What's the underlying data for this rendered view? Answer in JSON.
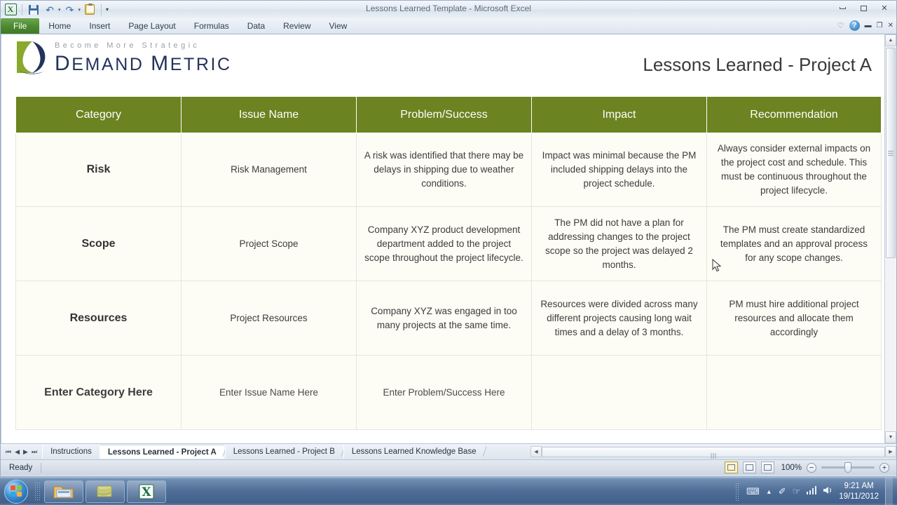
{
  "window": {
    "title": "Lessons Learned Template  -  Microsoft Excel",
    "minimize_label": "Minimize",
    "restore_label": "Restore Down",
    "close_label": "Close"
  },
  "quick_access": {
    "excel_logo": "X",
    "save_label": "Save",
    "undo_label": "Undo",
    "redo_label": "Redo",
    "print_preview_label": "Print Preview and Print",
    "customize_label": "Customize Quick Access Toolbar",
    "undo_glyph": "↶",
    "redo_glyph": "↷",
    "caret_glyph": "▾"
  },
  "ribbon": {
    "tabs": [
      {
        "label": "File",
        "active": true
      },
      {
        "label": "Home",
        "active": false
      },
      {
        "label": "Insert",
        "active": false
      },
      {
        "label": "Page Layout",
        "active": false
      },
      {
        "label": "Formulas",
        "active": false
      },
      {
        "label": "Data",
        "active": false
      },
      {
        "label": "Review",
        "active": false
      },
      {
        "label": "View",
        "active": false
      }
    ],
    "help_glyph": "?",
    "heart_glyph": "♡",
    "minimize_ribbon_glyph": "▬",
    "restore_ribbon_glyph": "❐",
    "close_ribbon_glyph": "✕"
  },
  "document": {
    "brand_tagline": "Become More Strategic",
    "brand_name_1": "D",
    "brand_name_2": "EMAND ",
    "brand_name_3": "M",
    "brand_name_4": "ETRIC",
    "brand_name_full": "DEMAND METRIC",
    "title": "Lessons Learned - Project A",
    "colors": {
      "header_green": "#6b8320",
      "logo_green": "#8aa82e",
      "logo_navy": "#22335c",
      "cell_bg": "#fdfdf5",
      "cell_border": "#e6e6de"
    }
  },
  "table": {
    "columns": [
      "Category",
      "Issue Name",
      "Problem/Success",
      "Impact",
      "Recommendation"
    ],
    "rows": [
      {
        "category": "Risk",
        "issue_name": "Risk Management",
        "problem_success": "A risk was identified that there may be delays in shipping due to weather conditions.",
        "impact": "Impact was minimal because the PM included shipping delays into the project schedule.",
        "recommendation": "Always consider external impacts on the project cost and schedule. This must be continuous throughout the project lifecycle."
      },
      {
        "category": "Scope",
        "issue_name": "Project Scope",
        "problem_success": "Company XYZ product development department added to the project scope throughout the project lifecycle.",
        "impact": "The PM did not have a plan for addressing changes to the project scope so the project was delayed 2 months.",
        "recommendation": "The PM must create standardized templates and an approval process for any scope changes."
      },
      {
        "category": "Resources",
        "issue_name": "Project Resources",
        "problem_success": "Company XYZ was engaged in too many projects at the same time.",
        "impact": "Resources were divided across many different projects causing long wait times and a delay of 3 months.",
        "recommendation": "PM must hire additional project resources and allocate them accordingly"
      },
      {
        "category": "Enter Category Here",
        "issue_name": "Enter Issue Name Here",
        "problem_success": "Enter Problem/Success Here",
        "impact": "",
        "recommendation": ""
      }
    ]
  },
  "sheet_tabs": {
    "first_glyph": "⏮",
    "prev_glyph": "◀",
    "next_glyph": "▶",
    "last_glyph": "⏭",
    "tabs": [
      {
        "label": "Instructions",
        "active": false
      },
      {
        "label": "Lessons Learned - Project A",
        "active": true
      },
      {
        "label": "Lessons Learned - Project B",
        "active": false
      },
      {
        "label": "Lessons Learned Knowledge Base",
        "active": false
      }
    ],
    "hscroll_left_glyph": "◀",
    "hscroll_right_glyph": "▶"
  },
  "status_bar": {
    "status_text": "Ready",
    "view_normal_label": "Normal",
    "view_layout_label": "Page Layout",
    "view_break_label": "Page Break Preview",
    "zoom_level": "100%",
    "zoom_out_glyph": "−",
    "zoom_in_glyph": "+"
  },
  "scrollbar": {
    "up_glyph": "▲",
    "down_glyph": "▼"
  },
  "taskbar": {
    "start_label": "Start",
    "apps": [
      {
        "name": "windows-explorer",
        "label": "Windows Explorer"
      },
      {
        "name": "sticky-notes",
        "label": "Notes"
      },
      {
        "name": "microsoft-excel",
        "label": "Microsoft Excel",
        "glyph": "X"
      }
    ],
    "tray": {
      "keyboard_glyph": "⌨",
      "show_hidden_glyph": "▲",
      "pin_glyph": "✐",
      "action_glyph": "☞",
      "network_glyph": "◥",
      "volume_glyph": "ᴴ",
      "time": "9:21 AM",
      "date": "19/11/2012"
    }
  }
}
